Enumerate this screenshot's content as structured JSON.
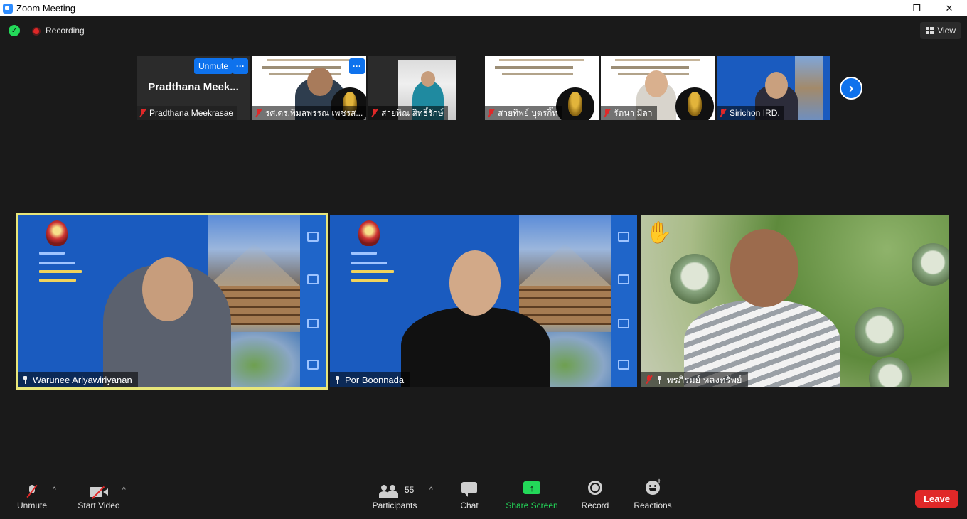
{
  "window": {
    "title": "Zoom Meeting",
    "controls": {
      "minimize": "—",
      "restore": "❐",
      "close": "✕"
    }
  },
  "topbar": {
    "security_icon": "shield-check-icon",
    "recording_label": "Recording",
    "view_label": "View"
  },
  "thumbnails": [
    {
      "display_name": "Pradthana  Meek...",
      "label": "Pradthana Meekrasae",
      "muted": true,
      "unmute_label": "Unmute",
      "more_label": "···"
    },
    {
      "label": "รศ.ดร.พิมลพรรณ เพชรส...",
      "muted": true,
      "more_label": "···"
    },
    {
      "label": "สายพิณ สิทธิ์รักษ์",
      "muted": true
    },
    {
      "label": "สายทิพย์  บุตรกิ๊ท",
      "muted": true
    },
    {
      "label": "รัตนา มีลา",
      "muted": true
    },
    {
      "label": "Sirichon IRD.",
      "muted": true
    }
  ],
  "gallery": [
    {
      "label": "Warunee Ariyawiriyanan",
      "pinned": true,
      "muted": false,
      "active_speaker": true
    },
    {
      "label": "Por Boonnada",
      "pinned": true,
      "muted": false,
      "active_speaker": false
    },
    {
      "label": "พรภิรมย์  หลงทรัพย์",
      "pinned": true,
      "muted": true,
      "active_speaker": false,
      "hand_raised": "✋"
    }
  ],
  "next_page_icon": "chevron-right-icon",
  "toolbar": {
    "unmute_label": "Unmute",
    "start_video_label": "Start Video",
    "participants_label": "Participants",
    "participants_count": "55",
    "chat_label": "Chat",
    "share_screen_label": "Share Screen",
    "record_label": "Record",
    "reactions_label": "Reactions",
    "leave_label": "Leave",
    "caret": "^"
  },
  "colors": {
    "accent": "#0e72ed",
    "leave": "#e02828",
    "share": "#23d959",
    "active_speaker": "#e8e67a"
  }
}
